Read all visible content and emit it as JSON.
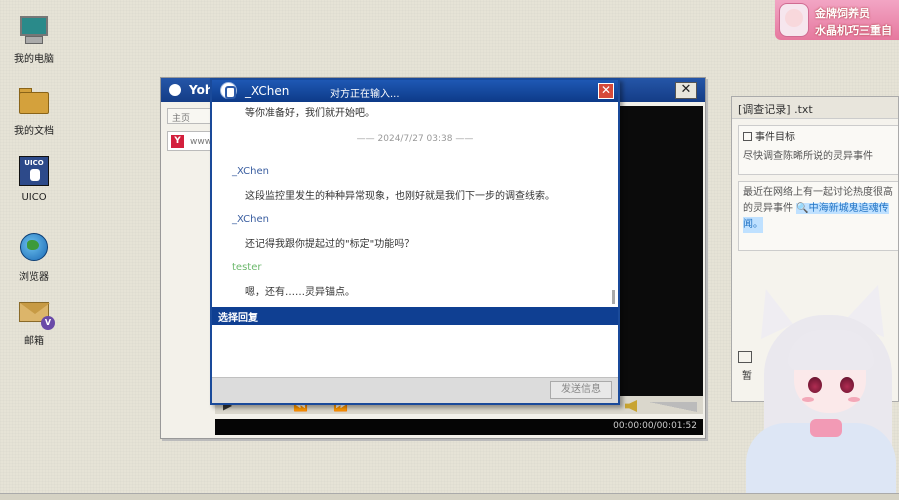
{
  "desktop": {
    "icons": [
      {
        "label": "我的电脑",
        "icon": "computer-icon"
      },
      {
        "label": "我的文档",
        "icon": "folder-icon"
      },
      {
        "label": "UICO",
        "icon": "uico-icon"
      },
      {
        "label": "浏览器",
        "icon": "globe-icon"
      },
      {
        "label": "邮箱",
        "icon": "mail-icon"
      }
    ]
  },
  "overlay_badge": {
    "line1": "金牌饲养员",
    "line2": "水晶机巧三重自"
  },
  "browser": {
    "title": "Yoh",
    "tab": "主页",
    "address": "www",
    "time": "00:00:00/00:01:52"
  },
  "chat": {
    "contact": "_XChen",
    "typing_status": "对方正在输入...",
    "close_label": "✕",
    "messages": [
      {
        "type": "text",
        "text": "等你准备好，我们就开始吧。"
      },
      {
        "type": "timestamp",
        "text": "——  2024/7/27 03:38  ——"
      },
      {
        "type": "sender",
        "text": "_XChen"
      },
      {
        "type": "text",
        "text": "这段监控里发生的种种异常现象，也刚好就是我们下一步的调查线索。"
      },
      {
        "type": "sender",
        "text": "_XChen"
      },
      {
        "type": "text",
        "text": "还记得我跟你提起过的\"标定\"功能吗？"
      },
      {
        "type": "sender",
        "text": "tester"
      },
      {
        "type": "text",
        "text": "嗯，还有……灵异锚点。"
      }
    ],
    "reply_header": "选择回复",
    "send_button": "发送信息"
  },
  "notes": {
    "title": "[调查记录] .txt",
    "goal_header": "事件目标",
    "goal_text": "尽快调查陈晞所说的灵异事件",
    "entry_text_1": "最近在网络上有一起讨论热度很高",
    "entry_text_2": "的灵异事件",
    "entry_link": "🔍中海新城鬼追魂传",
    "entry_link_tail": "闻。",
    "footer_text": "暂"
  },
  "colors": {
    "title_blue": "#1e58b4",
    "reply_bar": "#0f3f92",
    "desktop_bg": "#e6e3d6"
  }
}
